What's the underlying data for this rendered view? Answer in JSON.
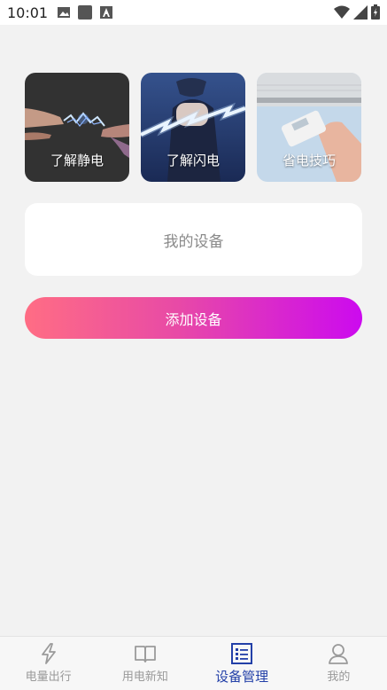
{
  "status_bar": {
    "time": "10:01",
    "left_icons": [
      "image-icon",
      "square-icon",
      "text-a-icon"
    ],
    "right_icons": [
      "wifi-icon",
      "signal-icon",
      "battery-icon"
    ]
  },
  "cards": [
    {
      "label": "了解静电",
      "icon": "static-electricity-image"
    },
    {
      "label": "了解闪电",
      "icon": "lightning-image"
    },
    {
      "label": "省电技巧",
      "icon": "remote-control-image"
    }
  ],
  "my_devices": {
    "label": "我的设备"
  },
  "add_device": {
    "label": "添加设备"
  },
  "bottom_nav": {
    "items": [
      {
        "label": "电量出行",
        "icon": "lightning-bolt-icon",
        "active": false
      },
      {
        "label": "用电新知",
        "icon": "book-icon",
        "active": false
      },
      {
        "label": "设备管理",
        "icon": "list-icon",
        "active": true
      },
      {
        "label": "我的",
        "icon": "user-icon",
        "active": false
      }
    ]
  },
  "colors": {
    "accent_active": "#2340a8",
    "gradient_start": "#ff6d84",
    "gradient_end": "#cc0aef",
    "background": "#f2f2f2"
  }
}
